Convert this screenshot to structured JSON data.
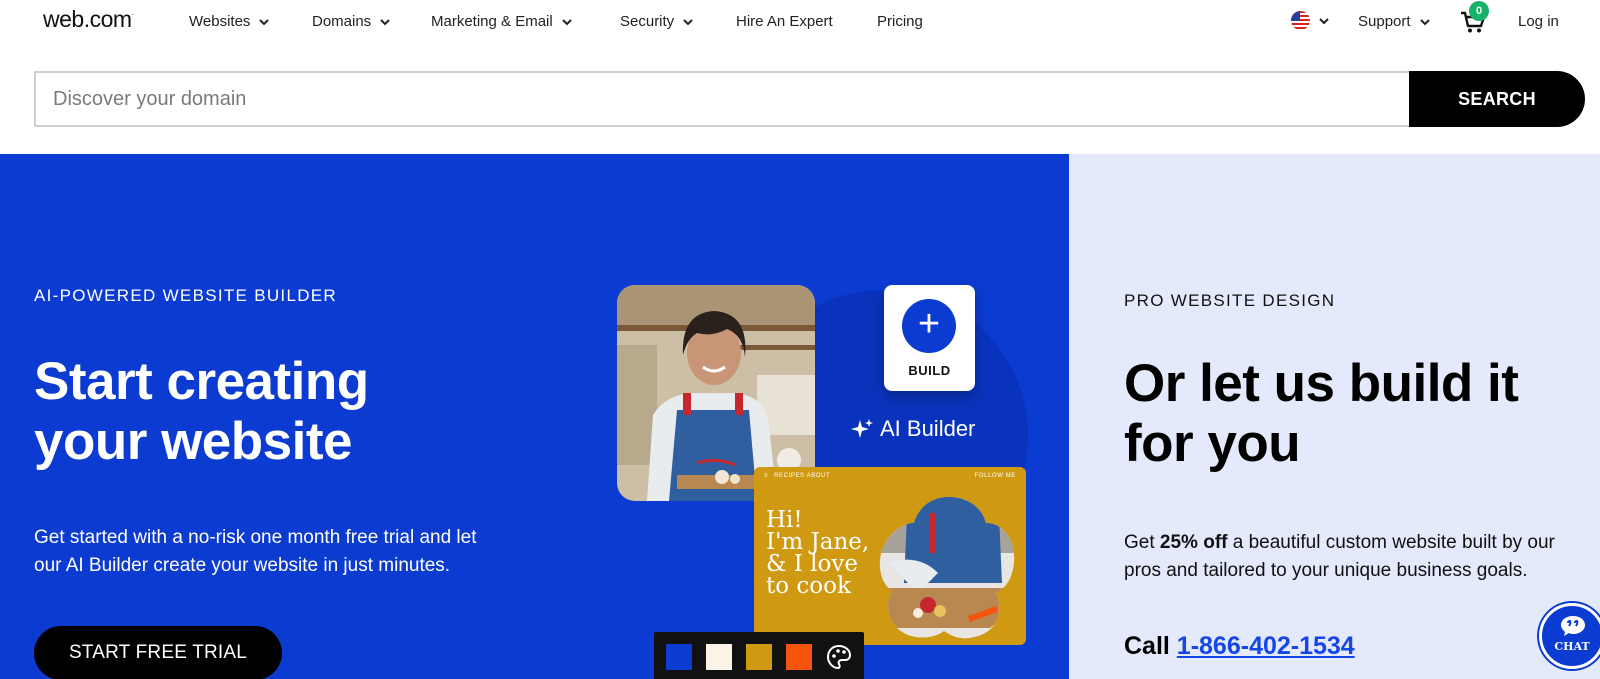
{
  "brand": {
    "logo_text": "web.com",
    "logo_mark": "·"
  },
  "nav": {
    "items": [
      {
        "label": "Websites",
        "has_dropdown": true
      },
      {
        "label": "Domains",
        "has_dropdown": true
      },
      {
        "label": "Marketing & Email",
        "has_dropdown": true
      },
      {
        "label": "Security",
        "has_dropdown": true
      },
      {
        "label": "Hire An Expert",
        "has_dropdown": false
      },
      {
        "label": "Pricing",
        "has_dropdown": false
      }
    ],
    "support_label": "Support",
    "cart_count": "0",
    "login_label": "Log in",
    "locale_icon": "us-flag-icon"
  },
  "search": {
    "placeholder": "Discover your domain",
    "button_label": "SEARCH"
  },
  "hero_left": {
    "eyebrow": "AI-POWERED WEBSITE BUILDER",
    "title_line1": "Start creating",
    "title_line2": "your website",
    "description": "Get started with a no-risk one month free trial and let our AI Builder create your website in just minutes.",
    "cta_label": "START FREE TRIAL",
    "build_card_label": "BUILD",
    "ai_builder_label": "AI Builder",
    "site_preview": {
      "nav_left": "RECIPES   ABOUT",
      "nav_right": "FOLLOW ME",
      "greeting_line1": "Hi!",
      "greeting_line2": "I'm Jane,",
      "greeting_line3": "& I love",
      "greeting_line4": "to cook"
    },
    "palette_colors": [
      "#0b3bd1",
      "#fbf4e6",
      "#cf9a12",
      "#f4540c"
    ]
  },
  "hero_right": {
    "eyebrow": "PRO WEBSITE DESIGN",
    "title_line1": "Or let us build it",
    "title_line2": "for you",
    "desc_prefix": "Get ",
    "desc_bold": "25% off",
    "desc_suffix": " a beautiful custom website built by our pros and tailored to your unique business goals.",
    "call_label": "Call ",
    "phone": "1-866-402-1534"
  },
  "chat": {
    "label": "CHAT"
  },
  "colors": {
    "brand_blue": "#0b3bd1",
    "light_panel": "#e4e9fc",
    "badge_green": "#17b26a",
    "link_blue": "#1546e8"
  }
}
